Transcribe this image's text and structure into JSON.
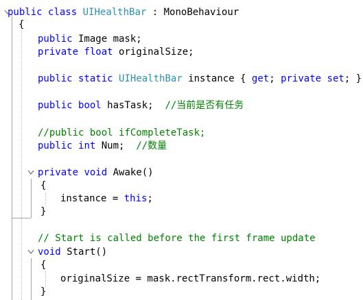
{
  "editor": {
    "lines": [
      {
        "tokens": [
          {
            "t": "public",
            "c": "kw"
          },
          {
            "t": " ",
            "c": "pl"
          },
          {
            "t": "class",
            "c": "kw"
          },
          {
            "t": " ",
            "c": "pl"
          },
          {
            "t": "UIHealthBar",
            "c": "type"
          },
          {
            "t": " : MonoBehaviour",
            "c": "pl"
          }
        ]
      },
      {
        "tokens": [
          {
            "t": "{",
            "c": "pl"
          }
        ]
      },
      {
        "tokens": [
          {
            "t": "public",
            "c": "kw"
          },
          {
            "t": " Image mask;",
            "c": "pl"
          }
        ]
      },
      {
        "tokens": [
          {
            "t": "private",
            "c": "kw"
          },
          {
            "t": " ",
            "c": "pl"
          },
          {
            "t": "float",
            "c": "kw"
          },
          {
            "t": " originalSize;",
            "c": "pl"
          }
        ]
      },
      {
        "tokens": []
      },
      {
        "tokens": [
          {
            "t": "public",
            "c": "kw"
          },
          {
            "t": " ",
            "c": "pl"
          },
          {
            "t": "static",
            "c": "kw"
          },
          {
            "t": " ",
            "c": "pl"
          },
          {
            "t": "UIHealthBar",
            "c": "type"
          },
          {
            "t": " instance { ",
            "c": "pl"
          },
          {
            "t": "get",
            "c": "kw"
          },
          {
            "t": "; ",
            "c": "pl"
          },
          {
            "t": "private",
            "c": "kw"
          },
          {
            "t": " ",
            "c": "pl"
          },
          {
            "t": "set",
            "c": "kw"
          },
          {
            "t": "; }",
            "c": "pl"
          }
        ]
      },
      {
        "tokens": []
      },
      {
        "tokens": [
          {
            "t": "public",
            "c": "kw"
          },
          {
            "t": " ",
            "c": "pl"
          },
          {
            "t": "bool",
            "c": "kw"
          },
          {
            "t": " hasTask;  ",
            "c": "pl"
          },
          {
            "t": "//当前是否有任务",
            "c": "cm"
          }
        ]
      },
      {
        "tokens": []
      },
      {
        "tokens": [
          {
            "t": "//public bool ifCompleteTask;",
            "c": "cm"
          }
        ]
      },
      {
        "tokens": [
          {
            "t": "public",
            "c": "kw"
          },
          {
            "t": " ",
            "c": "pl"
          },
          {
            "t": "int",
            "c": "kw"
          },
          {
            "t": " Num;  ",
            "c": "pl"
          },
          {
            "t": "//数量",
            "c": "cm"
          }
        ]
      },
      {
        "tokens": []
      },
      {
        "tokens": [
          {
            "t": "private",
            "c": "kw"
          },
          {
            "t": " ",
            "c": "pl"
          },
          {
            "t": "void",
            "c": "kw"
          },
          {
            "t": " Awake()",
            "c": "pl"
          }
        ]
      },
      {
        "tokens": [
          {
            "t": "{",
            "c": "pl"
          }
        ]
      },
      {
        "tokens": [
          {
            "t": "instance = ",
            "c": "pl"
          },
          {
            "t": "this",
            "c": "kw"
          },
          {
            "t": ";",
            "c": "pl"
          }
        ]
      },
      {
        "tokens": [
          {
            "t": "}",
            "c": "pl"
          }
        ]
      },
      {
        "tokens": []
      },
      {
        "tokens": [
          {
            "t": "// Start is called before the first frame update",
            "c": "cm"
          }
        ]
      },
      {
        "tokens": [
          {
            "t": "void",
            "c": "kw"
          },
          {
            "t": " Start()",
            "c": "pl"
          }
        ]
      },
      {
        "tokens": [
          {
            "t": "{",
            "c": "pl"
          }
        ]
      },
      {
        "tokens": [
          {
            "t": "originalSize = mask.rectTransform.rect.width;",
            "c": "pl"
          }
        ]
      },
      {
        "tokens": [
          {
            "t": "}",
            "c": "pl"
          }
        ]
      }
    ]
  },
  "colors": {
    "keyword": "#0000ff",
    "type": "#2b91af",
    "comment": "#008000",
    "plain": "#000000",
    "guide": "#a5a5a5",
    "background": "#ffffff"
  },
  "icons": {
    "fold": "chevron-down-icon"
  }
}
